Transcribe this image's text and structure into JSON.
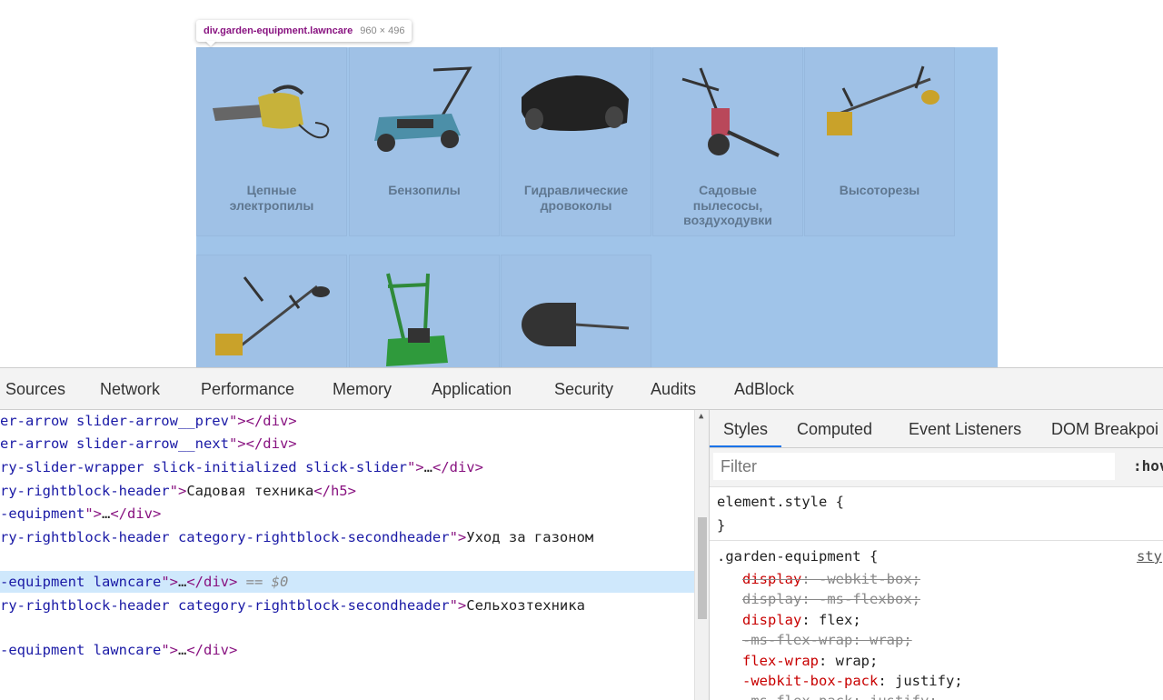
{
  "page": {
    "tooltip": {
      "selector": "div.garden-equipment.lawncare",
      "size": "960 × 496"
    },
    "tiles": [
      {
        "label": "Цепные\nэлектропилы"
      },
      {
        "label": "Бензопилы"
      },
      {
        "label": "Гидравлические\nдровоколы"
      },
      {
        "label": "Садовые\nпылесосы,\nвоздуходувки"
      },
      {
        "label": "Высоторезы"
      },
      {
        "label": ""
      },
      {
        "label": ""
      },
      {
        "label": ""
      }
    ]
  },
  "devtools": {
    "tabs": [
      "Sources",
      "Network",
      "Performance",
      "Memory",
      "Application",
      "Security",
      "Audits",
      "AdBlock"
    ],
    "elements": {
      "lines": [
        {
          "pre": "er-arrow slider-arrow__prev",
          "open": "\">",
          "close": "</div>",
          "text": ""
        },
        {
          "pre": "er-arrow slider-arrow__next",
          "open": "\">",
          "close": "</div>",
          "text": ""
        },
        {
          "pre": "ry-slider-wrapper slick-initialized slick-slider",
          "open": "\">",
          "close": "</div>",
          "text": "…"
        },
        {
          "pre": "ry-rightblock-header",
          "open": "\">",
          "close": "</h5>",
          "text": "Садовая техника"
        },
        {
          "pre": "-equipment",
          "open": "\">",
          "close": "</div>",
          "text": "…"
        },
        {
          "pre": "ry-rightblock-header category-rightblock-secondheader",
          "open": "\">",
          "close": "",
          "text": "Уход за газоном"
        },
        {
          "pre": "-equipment lawncare",
          "open": "\">",
          "close": "</div>",
          "text": "…",
          "selected": true,
          "marker": " == $0"
        },
        {
          "pre": "ry-rightblock-header category-rightblock-secondheader",
          "open": "\">",
          "close": "",
          "text": "Сельхозтехника"
        },
        {
          "pre": "-equipment lawncare",
          "open": "\">",
          "close": "</div>",
          "text": "…"
        }
      ]
    },
    "sidebar": {
      "tabs": [
        "Styles",
        "Computed",
        "Event Listeners",
        "DOM Breakpoi"
      ],
      "filter_placeholder": "Filter",
      "hov": ":hov",
      "element_style_open": "element.style {",
      "element_style_close": "}",
      "rule_selector": ".garden-equipment {",
      "rule_source": "sty",
      "declarations": [
        {
          "prop": "display",
          "value": "-webkit-box;",
          "struck": true
        },
        {
          "prop": "display",
          "value": "-ms-flexbox;",
          "struck": true
        },
        {
          "prop": "display",
          "value": "flex;",
          "struck": false
        },
        {
          "prop": "-ms-flex-wrap",
          "value": "wrap;",
          "struck": true
        },
        {
          "prop": "flex-wrap",
          "value": "wrap;",
          "struck": false
        },
        {
          "prop": "-webkit-box-pack",
          "value": "justify;",
          "struck": false
        },
        {
          "prop": "-ms-flex-pack",
          "value": "justify;",
          "struck": true
        }
      ]
    }
  }
}
